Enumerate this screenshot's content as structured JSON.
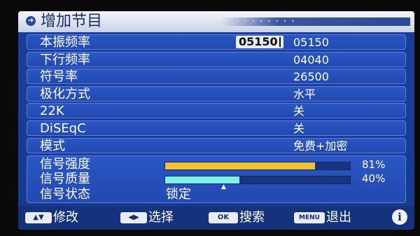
{
  "title": "增加节目",
  "rows": [
    {
      "label": "本振频率",
      "value": "05150",
      "edit_value": "05150"
    },
    {
      "label": "下行频率",
      "value": "04040"
    },
    {
      "label": "符号率",
      "value": "26500"
    },
    {
      "label": "极化方式",
      "value": "水平"
    },
    {
      "label": "22K",
      "value": "关"
    },
    {
      "label": "DiSEqC",
      "value": "关"
    },
    {
      "label": "模式",
      "value": "免费+加密"
    }
  ],
  "signal": {
    "strength_label": "信号强度",
    "strength_value": "81%",
    "strength_level": 0.81,
    "quality_label": "信号质量",
    "quality_value": "40%",
    "quality_level": 0.4,
    "status_label": "信号状态",
    "status_value": "锁定"
  },
  "footer": {
    "updown_badge": "▲▼",
    "updown_text": "修改",
    "leftright_badge": "◀▶",
    "leftright_text": "选择",
    "ok_badge": "OK",
    "ok_text": "搜索",
    "menu_badge": "MENU",
    "menu_text": "退出",
    "info_glyph": "i"
  },
  "colors": {
    "strength_bar": "#f2c230",
    "quality_bar": "#7ff0e8",
    "panel": "#1c3f9a",
    "row": "#2a57c4"
  }
}
